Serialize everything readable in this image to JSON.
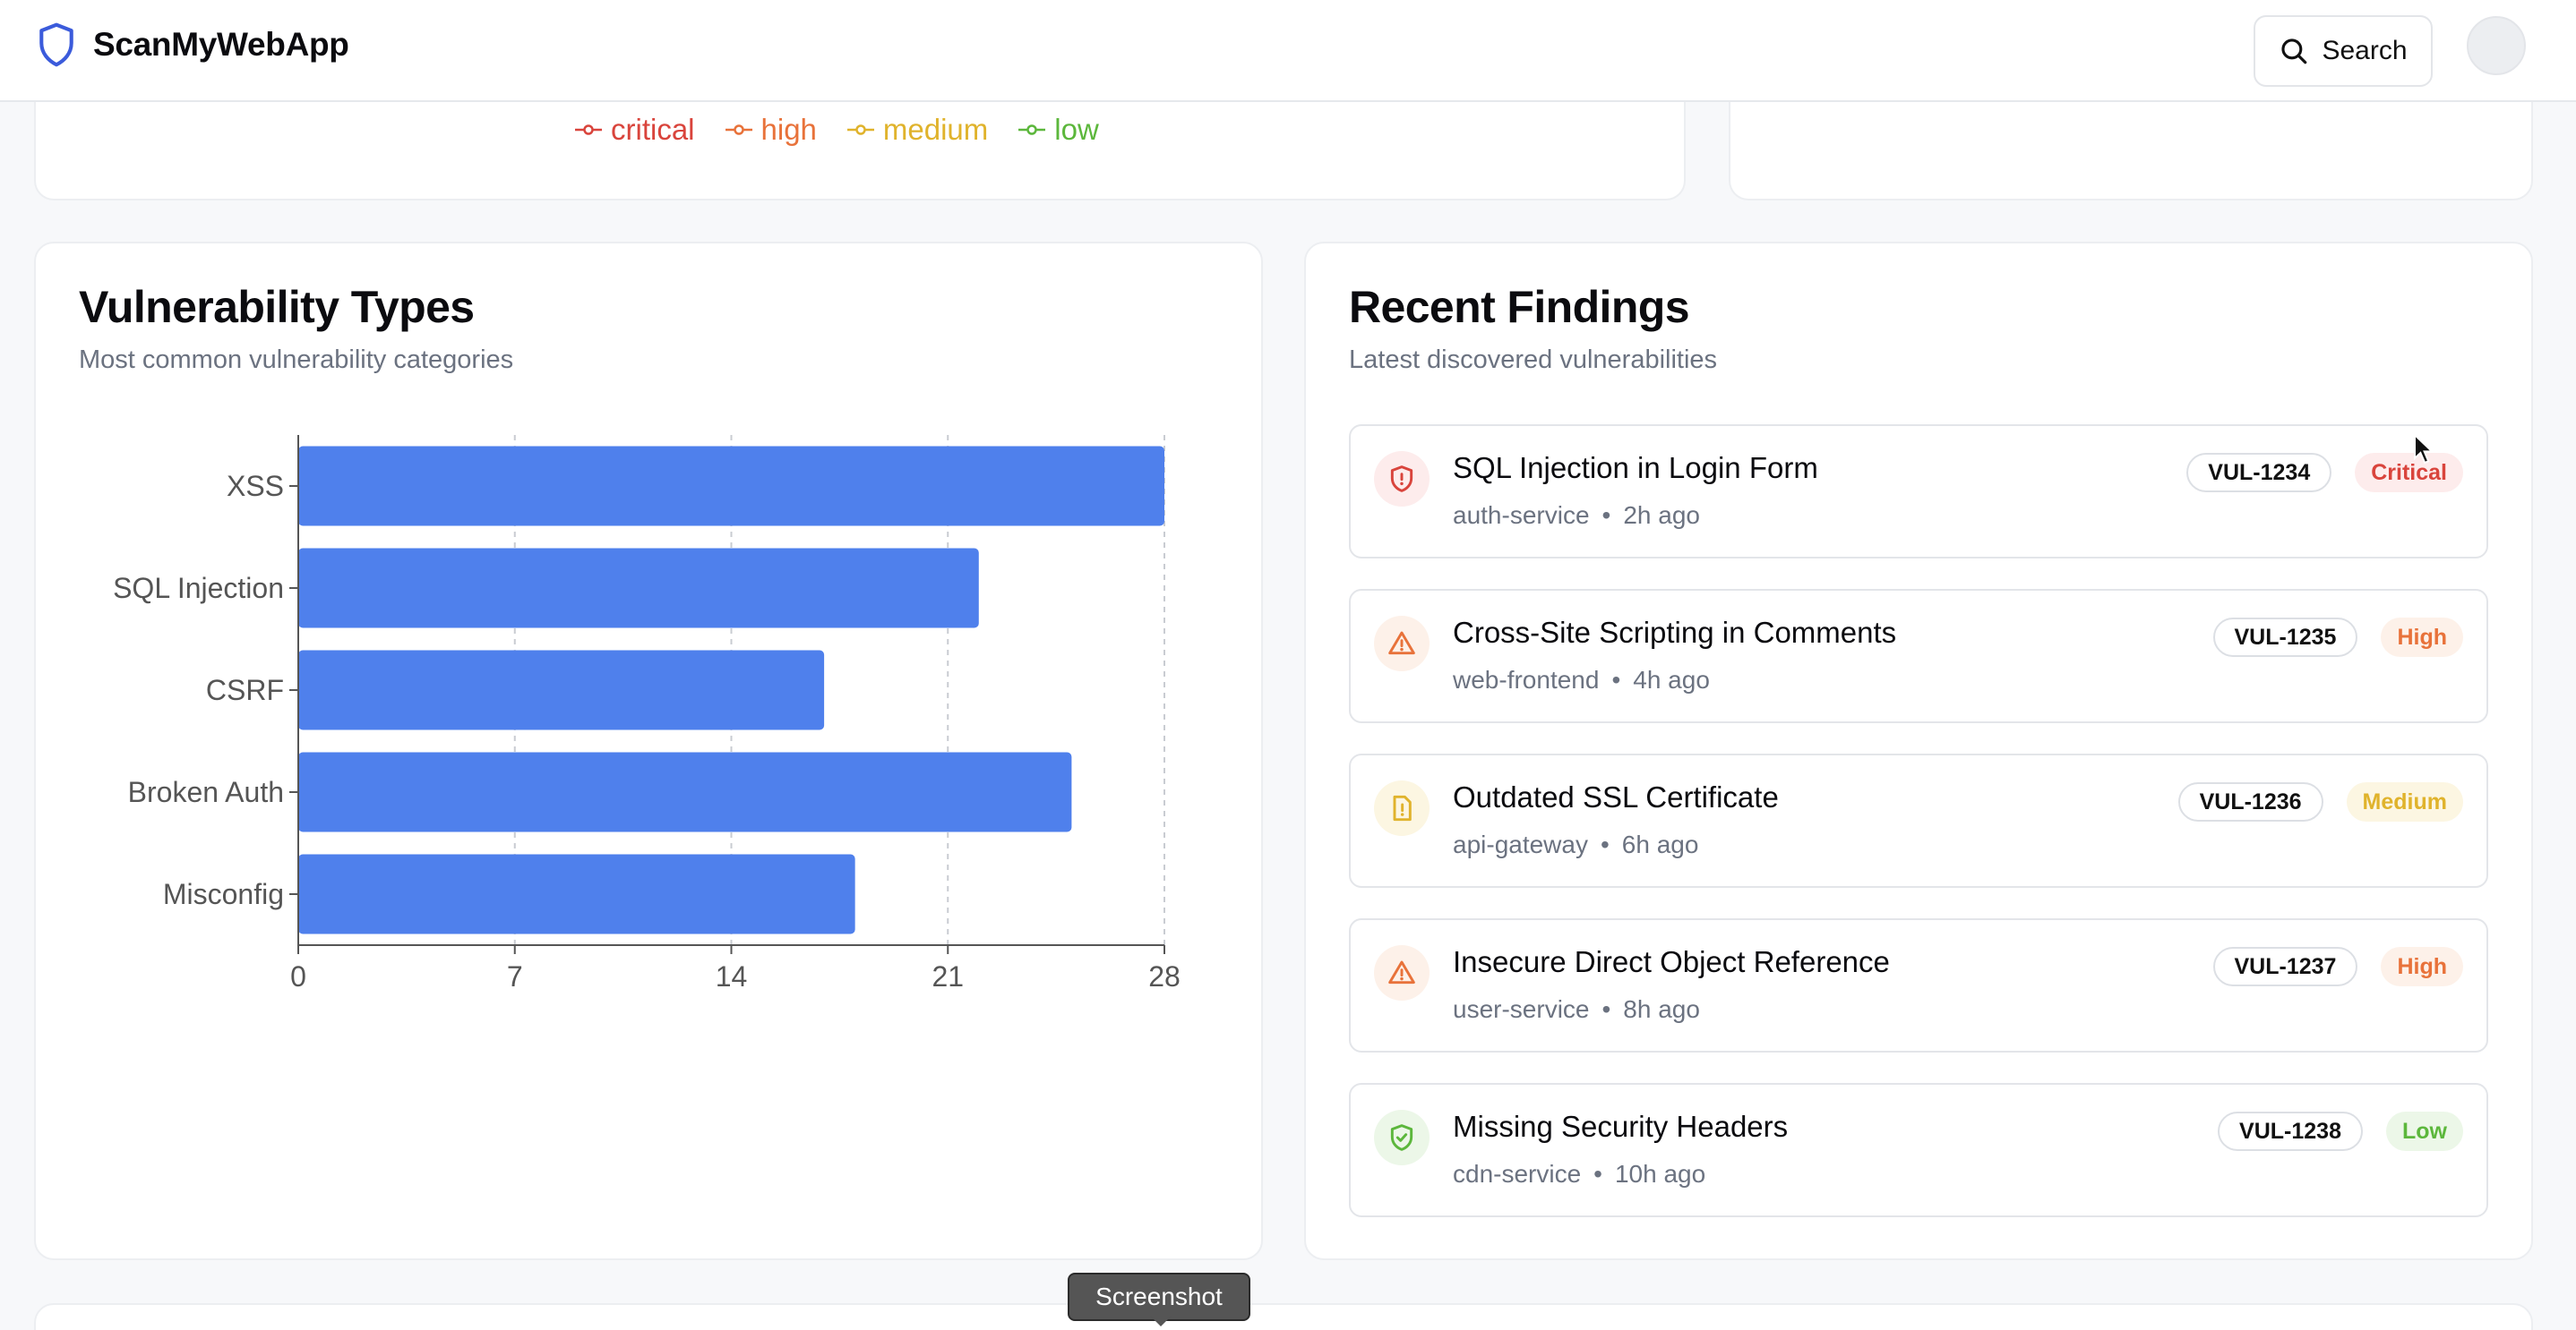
{
  "app": {
    "name": "ScanMyWebApp",
    "search_label": "Search"
  },
  "colors": {
    "bar": "#4f80ec",
    "critical": "#d9443c",
    "high": "#e8723a",
    "medium": "#e0b32c",
    "low": "#5cb73c",
    "muted": "#6b7280"
  },
  "severity_legend": [
    {
      "label": "critical",
      "color": "#d9443c"
    },
    {
      "label": "high",
      "color": "#e8723a"
    },
    {
      "label": "medium",
      "color": "#e0b32c"
    },
    {
      "label": "low",
      "color": "#5cb73c"
    }
  ],
  "types_card": {
    "title": "Vulnerability Types",
    "subtitle": "Most common vulnerability categories"
  },
  "chart_data": {
    "type": "bar",
    "orientation": "horizontal",
    "categories": [
      "XSS",
      "SQL Injection",
      "CSRF",
      "Broken Auth",
      "Misconfig"
    ],
    "values": [
      28,
      22,
      17,
      25,
      18
    ],
    "xlim": [
      0,
      28
    ],
    "xticks": [
      0,
      7,
      14,
      21,
      28
    ],
    "grid": "vertical dashed",
    "title": "",
    "xlabel": "",
    "ylabel": ""
  },
  "findings_card": {
    "title": "Recent Findings",
    "subtitle": "Latest discovered vulnerabilities"
  },
  "findings": [
    {
      "title": "SQL Injection in Login Form",
      "service": "auth-service",
      "time": "2h ago",
      "id": "VUL-1234",
      "severity": "Critical",
      "icon": "shield-alert-icon"
    },
    {
      "title": "Cross-Site Scripting in Comments",
      "service": "web-frontend",
      "time": "4h ago",
      "id": "VUL-1235",
      "severity": "High",
      "icon": "warning-triangle-icon"
    },
    {
      "title": "Outdated SSL Certificate",
      "service": "api-gateway",
      "time": "6h ago",
      "id": "VUL-1236",
      "severity": "Medium",
      "icon": "file-alert-icon"
    },
    {
      "title": "Insecure Direct Object Reference",
      "service": "user-service",
      "time": "8h ago",
      "id": "VUL-1237",
      "severity": "High",
      "icon": "warning-triangle-icon"
    },
    {
      "title": "Missing Security Headers",
      "service": "cdn-service",
      "time": "10h ago",
      "id": "VUL-1238",
      "severity": "Low",
      "icon": "shield-check-icon"
    }
  ],
  "meta_separator": "•",
  "tooltip": {
    "label": "Screenshot"
  }
}
